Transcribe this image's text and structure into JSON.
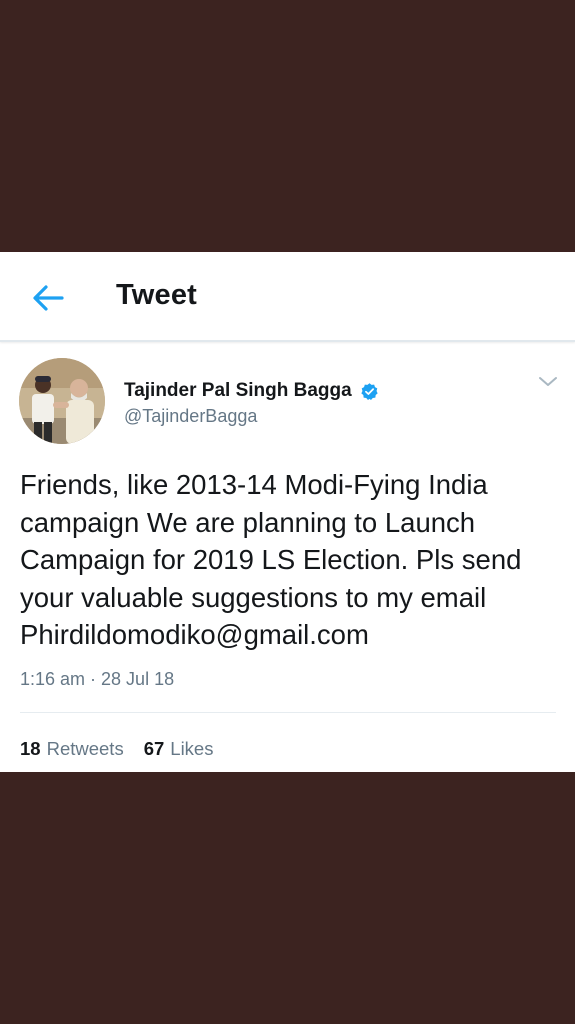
{
  "header": {
    "title": "Tweet",
    "back_icon": "arrow-left-icon"
  },
  "tweet": {
    "author_name": "Tajinder Pal Singh Bagga",
    "author_handle": "@TajinderBagga",
    "verified_icon": "verified-badge-icon",
    "menu_icon": "chevron-down-icon",
    "text": "Friends, like 2013-14 Modi-Fying India\ncampaign We are planning to Launch\nCampaign for 2019 LS Election. Pls send\nyour valuable suggestions to my email\nPhirdildomodiko@gmail.com",
    "timestamp": "1:16 am · 28 Jul 18",
    "retweets_count": "18",
    "retweets_label": "Retweets",
    "likes_count": "67",
    "likes_label": "Likes"
  },
  "colors": {
    "background": "#3c2320",
    "accent": "#1da1f2",
    "text_primary": "#14171a",
    "text_secondary": "#657786"
  }
}
